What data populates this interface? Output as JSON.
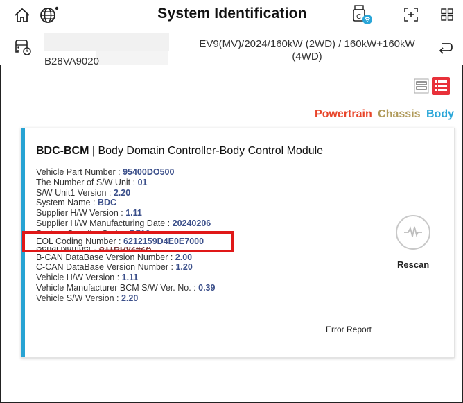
{
  "header": {
    "title": "System Identification"
  },
  "vehicle": {
    "vin": "B28VA9020",
    "model": "EV9(MV)/2024/160kW (2WD) / 160kW+160kW (4WD)"
  },
  "tabs": {
    "powertrain": "Powertrain",
    "chassis": "Chassis",
    "body": "Body"
  },
  "module": {
    "code": "BDC-BCM",
    "separator": " | ",
    "name": "Body Domain Controller-Body Control Module",
    "rows": [
      {
        "label": "Vehicle Part Number : ",
        "value": "95400DO500"
      },
      {
        "label": "The Number of S/W Unit : ",
        "value": "01"
      },
      {
        "label": "S/W Unit1 Version : ",
        "value": "2.20"
      },
      {
        "label": "System Name : ",
        "value": "BDC"
      },
      {
        "label": "Supplier H/W Version : ",
        "value": "1.11"
      },
      {
        "label": "Supplier H/W Manufacturing Date : ",
        "value": "20240206"
      },
      {
        "label": "System Supplier Code : ",
        "value": "B710"
      },
      {
        "label": "EOL Coding Number : ",
        "value": "6212159D4E0E7000"
      },
      {
        "label": "Serial Number : ",
        "value": "S11BD0242A"
      },
      {
        "label": "B-CAN DataBase Version Number : ",
        "value": "2.00"
      },
      {
        "label": "C-CAN DataBase Version Number : ",
        "value": "1.20"
      },
      {
        "label": "Vehicle H/W Version : ",
        "value": "1.11"
      },
      {
        "label": "Vehicle Manufacturer BCM S/W Ver. No. : ",
        "value": "0.39"
      },
      {
        "label": "Vehicle S/W Version : ",
        "value": "2.20"
      }
    ]
  },
  "actions": {
    "rescan": "Rescan",
    "error_report": "Error Report"
  },
  "colors": {
    "powertrain": "#e8452a",
    "chassis": "#b09a5a",
    "body": "#2aa6d8",
    "accent": "#27a3d3",
    "highlight": "#e01818"
  }
}
